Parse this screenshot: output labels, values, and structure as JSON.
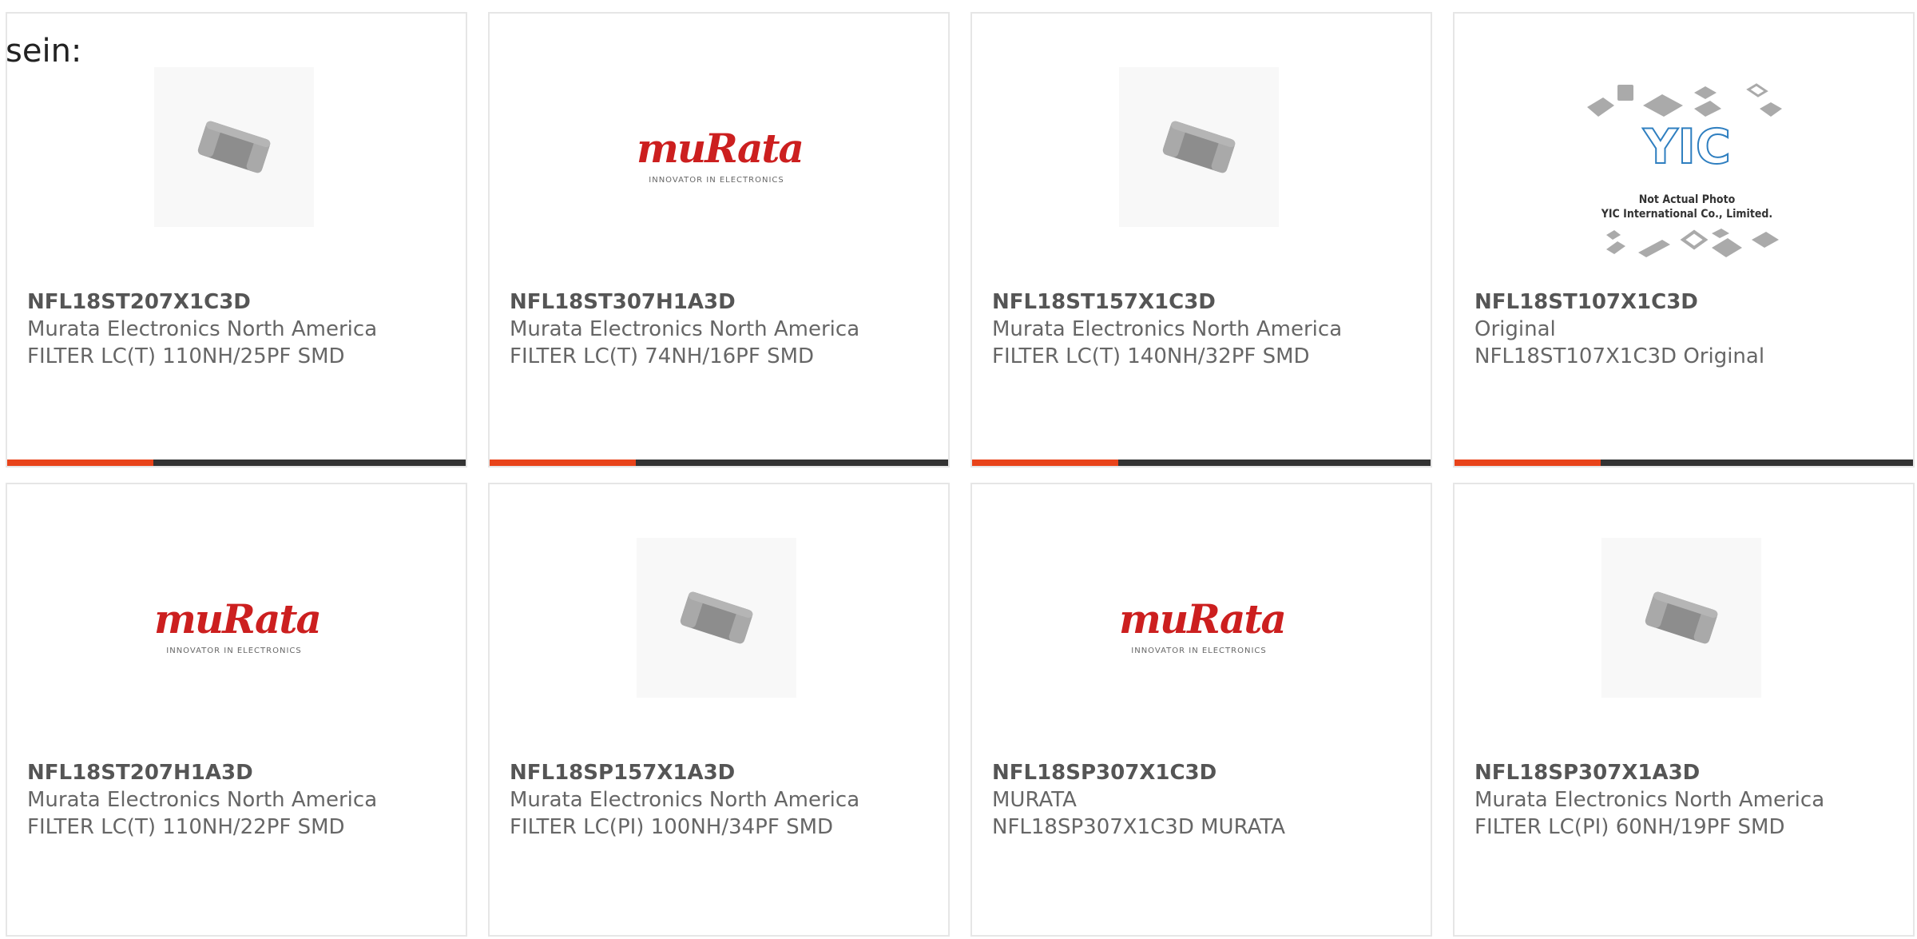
{
  "prefix_text": "sein:",
  "products": [
    {
      "part": "NFL18ST207X1C3D",
      "manufacturer": "Murata Electronics North America",
      "description": "FILTER LC(T) 110NH/25PF SMD",
      "image": "chip-photo"
    },
    {
      "part": "NFL18ST307H1A3D",
      "manufacturer": "Murata Electronics North America",
      "description": "FILTER LC(T) 74NH/16PF SMD",
      "image": "murata-logo"
    },
    {
      "part": "NFL18ST157X1C3D",
      "manufacturer": "Murata Electronics North America",
      "description": "FILTER LC(T) 140NH/32PF SMD",
      "image": "chip-photo"
    },
    {
      "part": "NFL18ST107X1C3D",
      "manufacturer": "Original",
      "description": "NFL18ST107X1C3D Original",
      "image": "yic-placeholder"
    },
    {
      "part": "NFL18ST207H1A3D",
      "manufacturer": "Murata Electronics North America",
      "description": "FILTER LC(T) 110NH/22PF SMD",
      "image": "murata-logo"
    },
    {
      "part": "NFL18SP157X1A3D",
      "manufacturer": "Murata Electronics North America",
      "description": "FILTER LC(PI) 100NH/34PF SMD",
      "image": "chip-photo"
    },
    {
      "part": "NFL18SP307X1C3D",
      "manufacturer": "MURATA",
      "description": "NFL18SP307X1C3D MURATA",
      "image": "murata-logo"
    },
    {
      "part": "NFL18SP307X1A3D",
      "manufacturer": "Murata Electronics North America",
      "description": "FILTER LC(PI) 60NH/19PF SMD",
      "image": "chip-photo"
    }
  ],
  "logos": {
    "murata_name": "muRata",
    "murata_tagline": "INNOVATOR IN ELECTRONICS",
    "yic_mark": "YIC",
    "yic_note_line1": "Not Actual Photo",
    "yic_note_line2": "YIC International Co., Limited."
  },
  "colors": {
    "accent": "#e8431a",
    "bar": "#333333",
    "murata_red": "#cc1f1f",
    "yic_blue": "#2f7fc0"
  }
}
